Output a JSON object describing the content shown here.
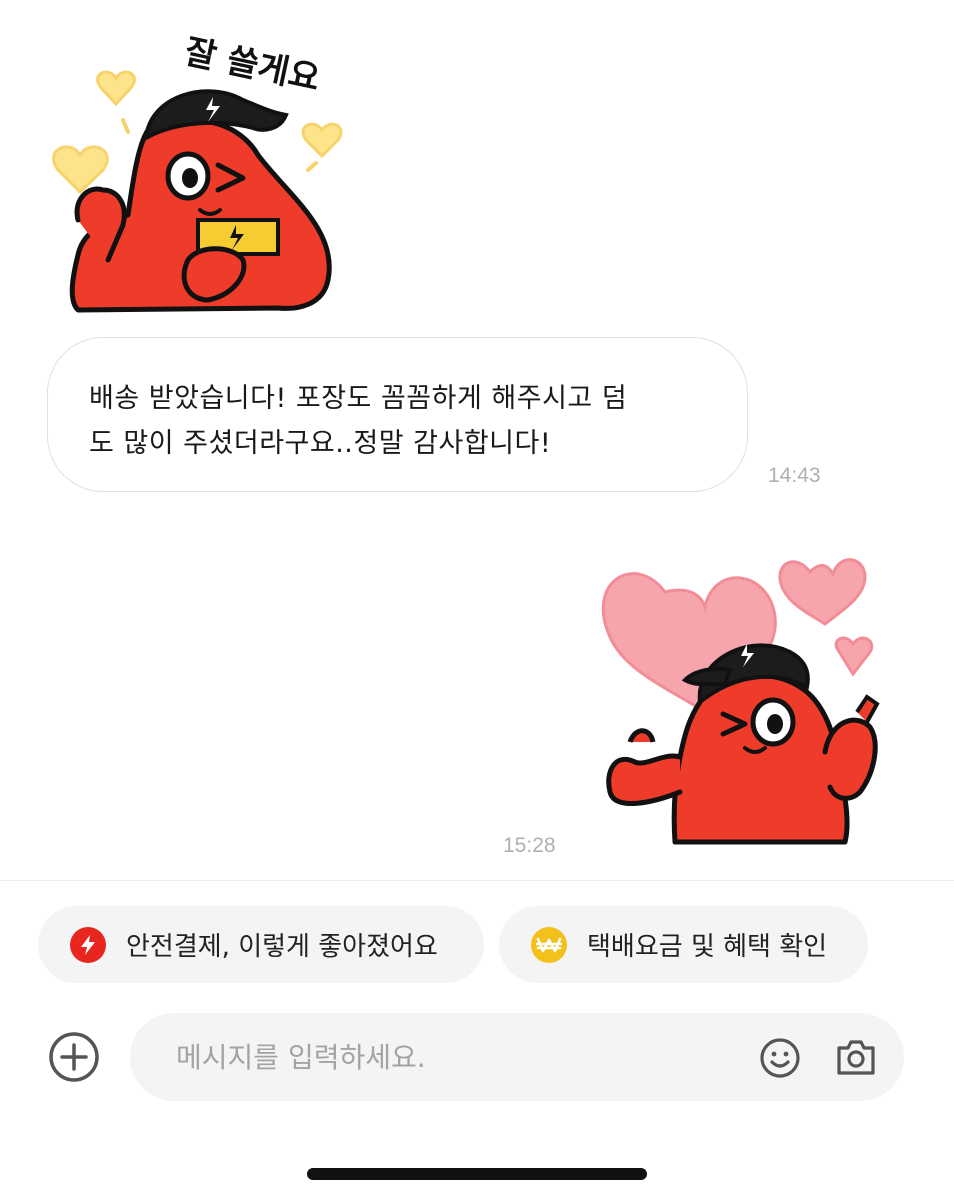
{
  "stickers": {
    "incoming_caption": "잘 쓸게요"
  },
  "messages": [
    {
      "direction": "incoming",
      "text": "배송 받았습니다! 포장도 꼼꼼하게 해주시고 덤도 많이 주셨더라구요..정말 감사합니다!",
      "line1": "배송 받았습니다! 포장도 꼼꼼하게 해주시고 덤",
      "line2": "도 많이 주셨더라구요..정말 감사합니다!",
      "time": "14:43"
    },
    {
      "direction": "outgoing",
      "type": "sticker",
      "time": "15:28"
    }
  ],
  "quick_replies": [
    {
      "label": "안전결제, 이렇게 좋아졌어요",
      "icon": "lightning-icon",
      "color": "#e8251e"
    },
    {
      "label": "택배요금 및 혜택 확인",
      "icon": "won-coin-icon",
      "color": "#f3c01c"
    }
  ],
  "composer": {
    "placeholder": "메시지를 입력하세요.",
    "value": "",
    "icons": [
      "plus-circle-icon",
      "smiley-icon",
      "camera-icon"
    ]
  },
  "colors": {
    "character_red": "#ee3b2a",
    "bubble_border": "#e1e1e1",
    "chip_bg": "#f4f4f4",
    "heart_pink": "#f7a5ad",
    "heart_yellow": "#fde48a"
  }
}
